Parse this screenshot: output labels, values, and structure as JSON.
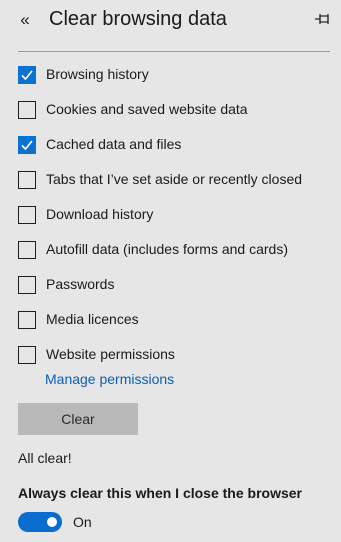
{
  "header": {
    "back_icon": "double-chevron-left-icon",
    "title": "Clear browsing data",
    "pin_icon": "pin-icon"
  },
  "options": [
    {
      "label": "Browsing history",
      "checked": true
    },
    {
      "label": "Cookies and saved website data",
      "checked": false
    },
    {
      "label": "Cached data and files",
      "checked": true
    },
    {
      "label": "Tabs that I’ve set aside or recently closed",
      "checked": false
    },
    {
      "label": "Download history",
      "checked": false
    },
    {
      "label": "Autofill data (includes forms and cards)",
      "checked": false
    },
    {
      "label": "Passwords",
      "checked": false
    },
    {
      "label": "Media licences",
      "checked": false
    },
    {
      "label": "Website permissions",
      "checked": false
    }
  ],
  "manage_link": "Manage permissions",
  "clear_button": "Clear",
  "status": "All clear!",
  "always_clear": {
    "heading": "Always clear this when I close the browser",
    "toggle_on": true,
    "toggle_label": "On"
  },
  "colors": {
    "background": "#e6e6e6",
    "accent": "#0b72d1",
    "link": "#0a5fb4",
    "button": "#b9b9b9"
  }
}
